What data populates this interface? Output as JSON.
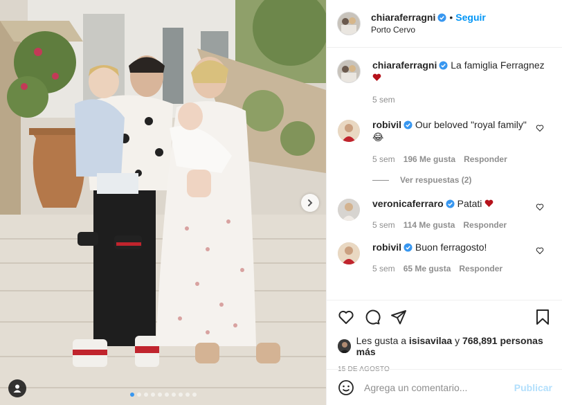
{
  "header": {
    "username": "chiaraferragni",
    "bullet": "•",
    "follow_label": "Seguir",
    "location": "Porto Cervo"
  },
  "caption": {
    "username": "chiaraferragni",
    "text": "La famiglia Ferragnez",
    "time": "5 sem",
    "heart_emoji": "red-heart"
  },
  "comments": [
    {
      "username": "robivil",
      "text": "Our beloved \"royal family\" 😂",
      "time": "5 sem",
      "likes": "196 Me gusta",
      "reply": "Responder"
    },
    {
      "username": "veronicaferraro",
      "text": "Patati",
      "time": "5 sem",
      "likes": "114 Me gusta",
      "reply": "Responder"
    },
    {
      "username": "robivil",
      "text": "Buon ferragosto!",
      "time": "5 sem",
      "likes": "65 Me gusta",
      "reply": "Responder"
    }
  ],
  "view_replies": "Ver respuestas (2)",
  "likes": {
    "prefix": "Les gusta a",
    "user": "isisavilaa",
    "connector": "y",
    "count": "768,891 personas más"
  },
  "date": "15 DE AGOSTO",
  "add_comment": {
    "placeholder": "Agrega un comentario...",
    "publish": "Publicar"
  },
  "carousel": {
    "slide_count": 10,
    "active_index": 0
  },
  "colors": {
    "link_blue": "#0095f6",
    "verified_blue": "#3897f0",
    "heart_red": "#ed4956"
  }
}
